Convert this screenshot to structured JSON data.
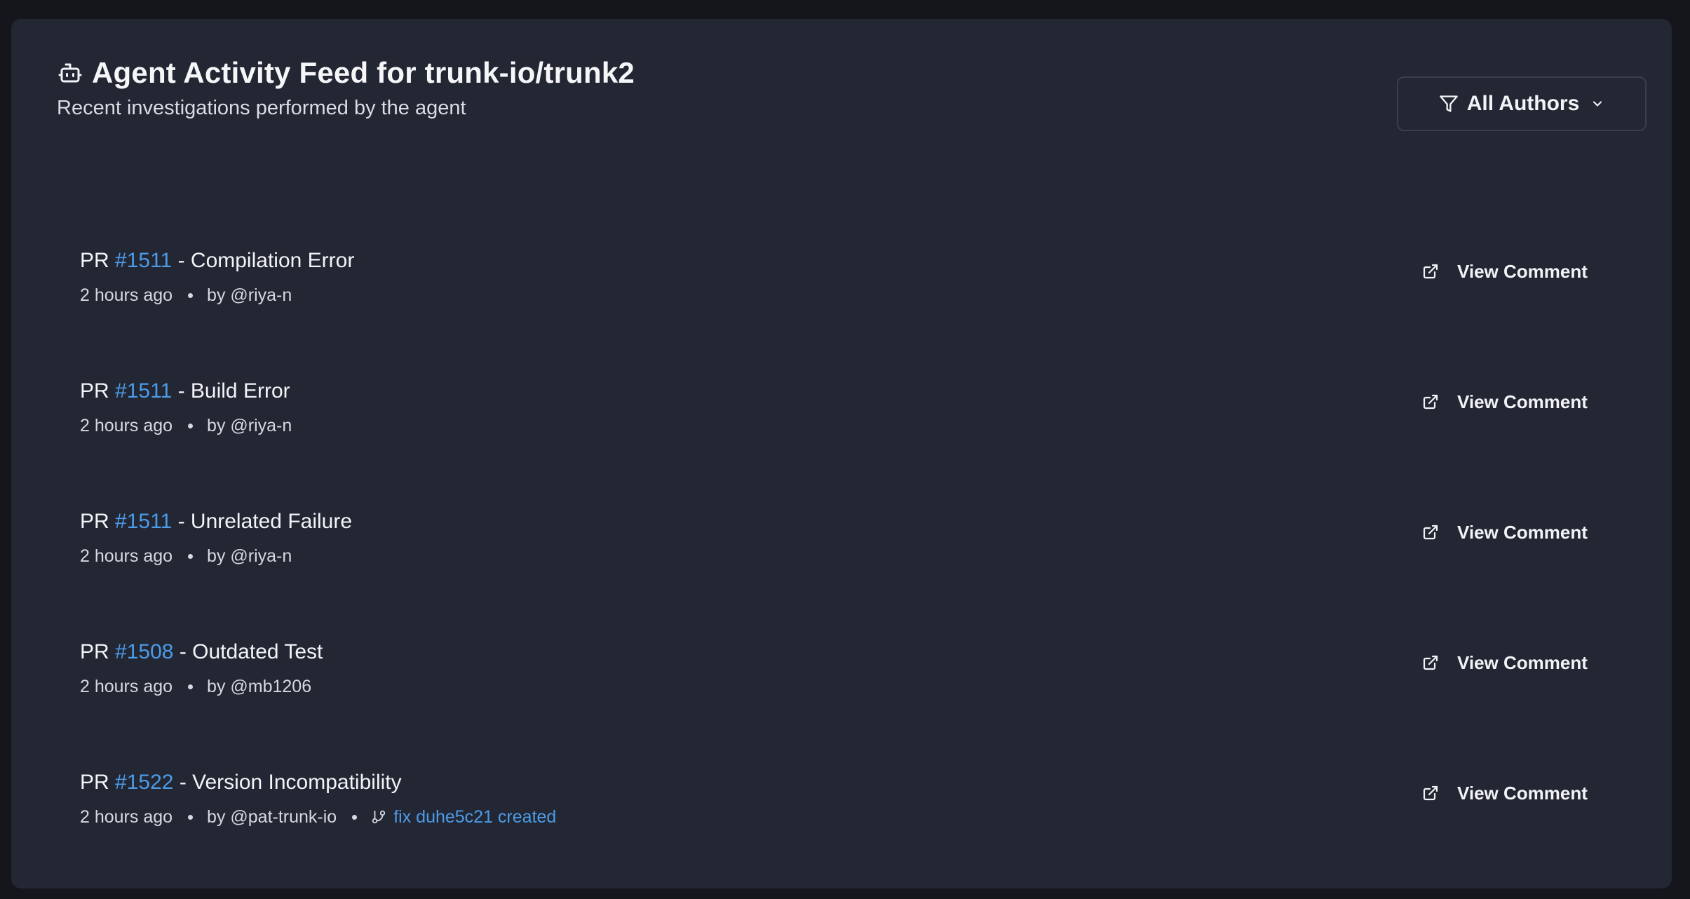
{
  "header": {
    "title": "Agent Activity Feed for trunk-io/trunk2",
    "subtitle": "Recent investigations performed by the agent",
    "icon": "bot-icon"
  },
  "filter": {
    "label": "All Authors",
    "icon": "filter-icon",
    "chevron": "chevron-down-icon"
  },
  "colors": {
    "background": "#14161c",
    "panel": "#232633",
    "link": "#4c9be8",
    "text": "#f1f3f6"
  },
  "items": [
    {
      "prefix": "PR",
      "pr": "#1511",
      "title": "- Compilation Error",
      "time": "2 hours ago",
      "author": "by @riya-n",
      "fix": null,
      "action": "View Comment"
    },
    {
      "prefix": "PR",
      "pr": "#1511",
      "title": "- Build Error",
      "time": "2 hours ago",
      "author": "by @riya-n",
      "fix": null,
      "action": "View Comment"
    },
    {
      "prefix": "PR",
      "pr": "#1511",
      "title": "- Unrelated Failure",
      "time": "2 hours ago",
      "author": "by @riya-n",
      "fix": null,
      "action": "View Comment"
    },
    {
      "prefix": "PR",
      "pr": "#1508",
      "title": "- Outdated Test",
      "time": "2 hours ago",
      "author": "by @mb1206",
      "fix": null,
      "action": "View Comment"
    },
    {
      "prefix": "PR",
      "pr": "#1522",
      "title": "- Version Incompatibility",
      "time": "2 hours ago",
      "author": "by @pat-trunk-io",
      "fix": "fix duhe5c21 created",
      "action": "View Comment"
    }
  ]
}
